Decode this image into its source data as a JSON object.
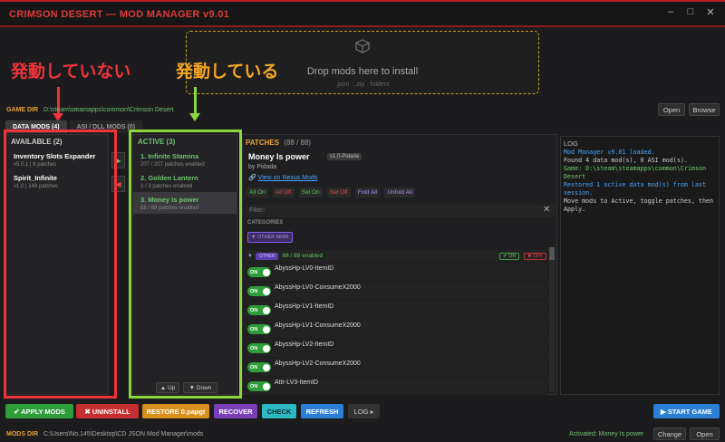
{
  "window": {
    "title": "CRIMSON DESERT — MOD MANAGER v9.01",
    "min": "–",
    "max": "□",
    "close": "✕"
  },
  "dropzone": {
    "message": "Drop mods here to install",
    "formats": ".json · .zip · folders"
  },
  "annotations": {
    "not_active": "発動していない",
    "active": "発動している"
  },
  "gamedir": {
    "label": "GAME DIR",
    "path": "D:\\steam\\steamapps\\common\\Crimson Desert",
    "open": "Open",
    "browse": "Browse"
  },
  "tabs": [
    "DATA MODS (4)",
    "ASI / DLL MODS (0)"
  ],
  "available": {
    "header": "AVAILABLE (2)",
    "items": [
      {
        "name": "Inventory Slots Expander",
        "meta": "v5.0.1 | 8 patches"
      },
      {
        "name": "Spirit_Infinite",
        "meta": "v1.0 | 149 patches"
      }
    ]
  },
  "active": {
    "header": "ACTIVE (3)",
    "items": [
      {
        "name": "1. Infinite Stamina",
        "meta": "207 / 207 patches enabled"
      },
      {
        "name": "2. Golden Lantern",
        "meta": "3 / 3 patches enabled"
      },
      {
        "name": "3. Money Is power",
        "meta": "88 / 88 patches enabled"
      }
    ],
    "up": "▲ Up",
    "down": "▼ Down"
  },
  "patches": {
    "header": "PATCHES",
    "count": "(88 / 88)",
    "mod_name": "Money Is power",
    "version": "v1.0-Pidada",
    "author": "by Pidada",
    "nexus": "View on Nexus Mods",
    "buttons": [
      "All On",
      "All Off",
      "Sel On",
      "Sel Off",
      "Fold All",
      "Unfold All"
    ],
    "filter_placeholder": "Filter:",
    "categories_label": "CATEGORIES",
    "category_chip": "▼ OTHER 88/88",
    "group_tag": "OTHER",
    "group_count": "88 / 88 enabled",
    "group_on": "✔ ON",
    "group_off": "✖ OFF",
    "toggle_label": "ON",
    "items": [
      "AbyssHp-LV0-ItemID",
      "AbyssHp-LV0-ConsumeX2000",
      "AbyssHp-LV1-ItemID",
      "AbyssHp-LV1-ConsumeX2000",
      "AbyssHp-LV2-ItemID",
      "AbyssHp-LV2-ConsumeX2000",
      "Attr-LV3-ItemID"
    ]
  },
  "log": {
    "header": "LOG",
    "lines": [
      {
        "text": "Mod Manager v9.01 loaded.",
        "color": "#4aa3ff"
      },
      {
        "text": "Found 4 data mod(s), 0 ASI mod(s).",
        "color": "#cccccc"
      },
      {
        "text": "Game: D:\\steam\\steamapps\\common\\Crimson Desert",
        "color": "#6fcf6f"
      },
      {
        "text": "Restored 1 active data mod(s) from last session.",
        "color": "#4aa3ff"
      },
      {
        "text": "Move mods to Active, toggle patches, then Apply.",
        "color": "#cccccc"
      }
    ]
  },
  "bottom": {
    "apply": "✔ APPLY MODS",
    "uninstall": "✖ UNINSTALL",
    "restore": "RESTORE 0.papgt",
    "recover": "RECOVER",
    "check": "CHECK",
    "refresh": "REFRESH",
    "log": "LOG ▸",
    "start": "▶ START GAME"
  },
  "modsdir": {
    "label": "MODS DIR",
    "path": "C:\\Users\\No.145\\Desktop\\CD JSON Mod Manager\\mods",
    "activated": "Activated: Money Is power",
    "change": "Change",
    "open": "Open"
  }
}
